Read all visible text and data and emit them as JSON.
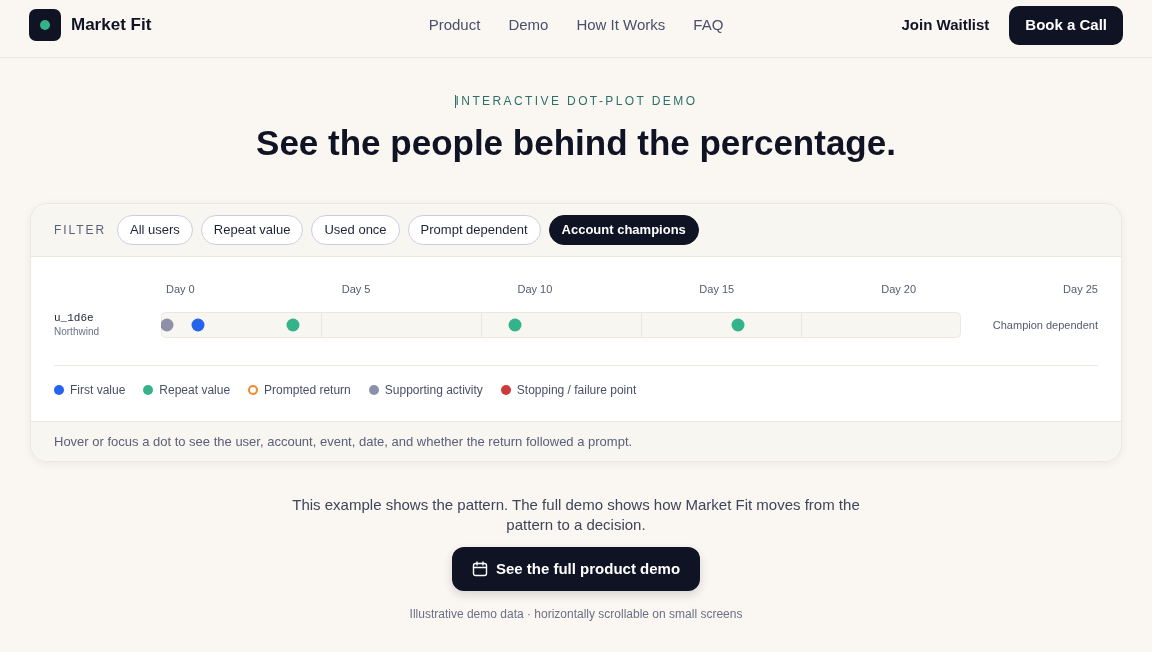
{
  "header": {
    "brand": "Market Fit",
    "nav": [
      {
        "label": "Product"
      },
      {
        "label": "Demo"
      },
      {
        "label": "How It Works"
      },
      {
        "label": "FAQ"
      }
    ],
    "join": "Join Waitlist",
    "cta": "Book a Call"
  },
  "hero": {
    "eyebrow": "INTERACTIVE DOT-PLOT DEMO",
    "title": "See the people behind the percentage."
  },
  "demo": {
    "filter_label": "FILTER",
    "filters": [
      {
        "label": "All users",
        "selected": false
      },
      {
        "label": "Repeat value",
        "selected": false
      },
      {
        "label": "Used once",
        "selected": false
      },
      {
        "label": "Prompt dependent",
        "selected": false
      },
      {
        "label": "Account champions",
        "selected": true
      }
    ],
    "day_labels": [
      "Day 0",
      "Day 5",
      "Day 10",
      "Day 15",
      "Day 20",
      "Day 25"
    ],
    "rows": [
      {
        "user": "u_1d6e",
        "account": "Northwind",
        "status": "Champion dependent",
        "events": [
          {
            "color": "#8e90a9"
          },
          {
            "color": "#2563eb"
          },
          {
            "color": "#34b38a"
          },
          {
            "color": "#34b38a"
          },
          {
            "color": "#34b38a"
          }
        ]
      }
    ],
    "legend": [
      {
        "label": "First value",
        "color": "#2563eb",
        "kind": "filled"
      },
      {
        "label": "Repeat value",
        "color": "#34b38a",
        "kind": "filled"
      },
      {
        "label": "Prompted return",
        "color": "#ef8a2e",
        "kind": "ring"
      },
      {
        "label": "Supporting activity",
        "color": "#8e90a9",
        "kind": "filled"
      },
      {
        "label": "Stopping / failure point",
        "color": "#cc3a3a",
        "kind": "filled"
      }
    ],
    "hint": "Hover or focus a dot to see the user, account, event, date, and whether the return followed a prompt."
  },
  "footer": {
    "text": "This example shows the pattern. The full demo shows how Market Fit moves from the pattern to a decision.",
    "button": "See the full product demo",
    "caption": "Illustrative demo data · horizontally scrollable on small screens"
  }
}
